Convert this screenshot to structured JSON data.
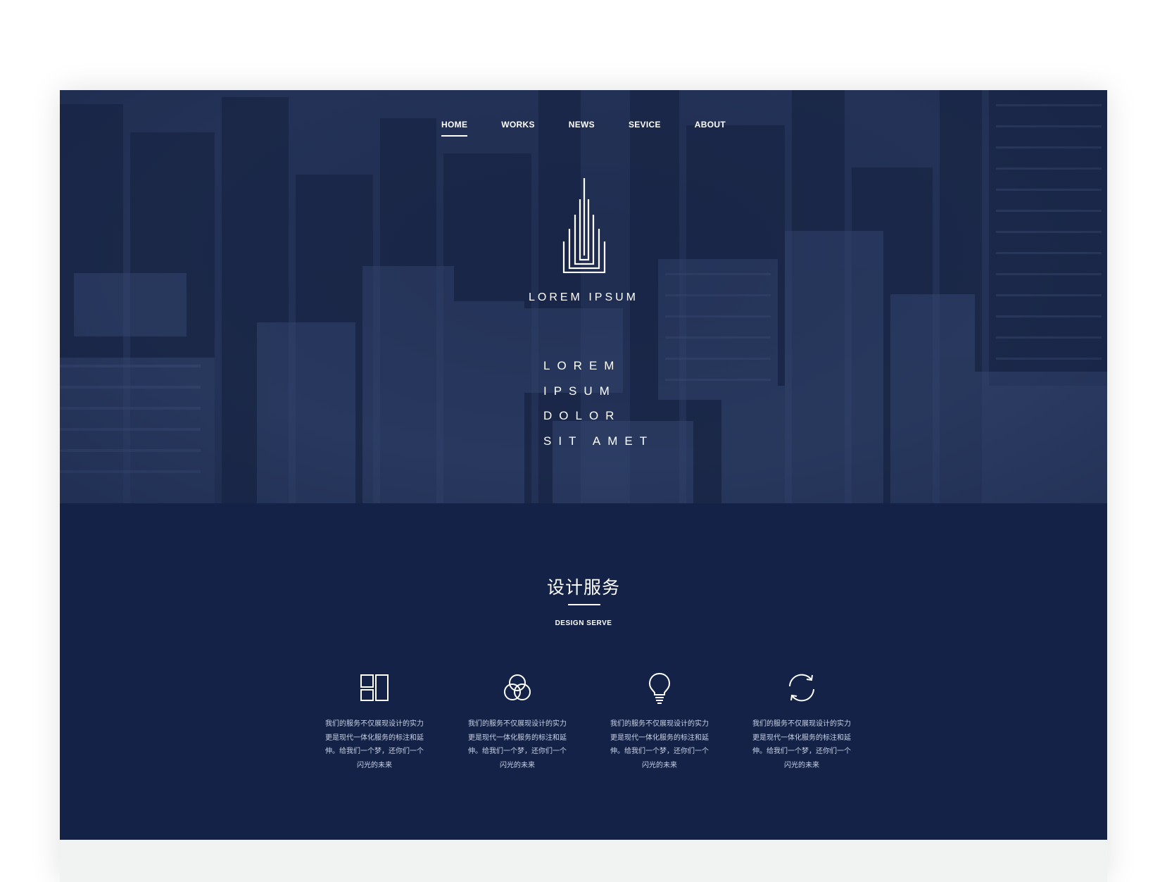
{
  "nav": {
    "items": [
      {
        "label": "HOME",
        "active": true
      },
      {
        "label": "WORKS",
        "active": false
      },
      {
        "label": "NEWS",
        "active": false
      },
      {
        "label": "SEVICE",
        "active": false
      },
      {
        "label": "ABOUT",
        "active": false
      }
    ]
  },
  "hero": {
    "brand": "LOREM IPSUM",
    "stacked_lines": [
      "LOREM",
      "IPSUM",
      "DOLOR",
      "SIT AMET"
    ],
    "logo_icon": "building-logo-icon"
  },
  "serve": {
    "title": "设计服务",
    "subtitle": "DESIGN SERVE",
    "features": [
      {
        "icon": "layout-grid-icon",
        "lines": [
          "我们的服务不仅展现设计的实力",
          "更是现代一体化服务的标注和延",
          "伸。给我们一个梦，还你们一个",
          "闪光的未来"
        ]
      },
      {
        "icon": "overlap-circles-icon",
        "lines": [
          "我们的服务不仅展现设计的实力",
          "更是现代一体化服务的标注和延",
          "伸。给我们一个梦，还你们一个",
          "闪光的未来"
        ]
      },
      {
        "icon": "lightbulb-icon",
        "lines": [
          "我们的服务不仅展现设计的实力",
          "更是现代一体化服务的标注和延",
          "伸。给我们一个梦，还你们一个",
          "闪光的未来"
        ]
      },
      {
        "icon": "refresh-icon",
        "lines": [
          "我们的服务不仅展现设计的实力",
          "更是现代一体化服务的标注和延",
          "伸。给我们一个梦，还你们一个",
          "闪光的未来"
        ]
      }
    ]
  },
  "colors": {
    "hero_tint": "#283a62",
    "section_bg": "#132246",
    "footer_bg": "#f1f2f2",
    "text": "#ffffff"
  }
}
